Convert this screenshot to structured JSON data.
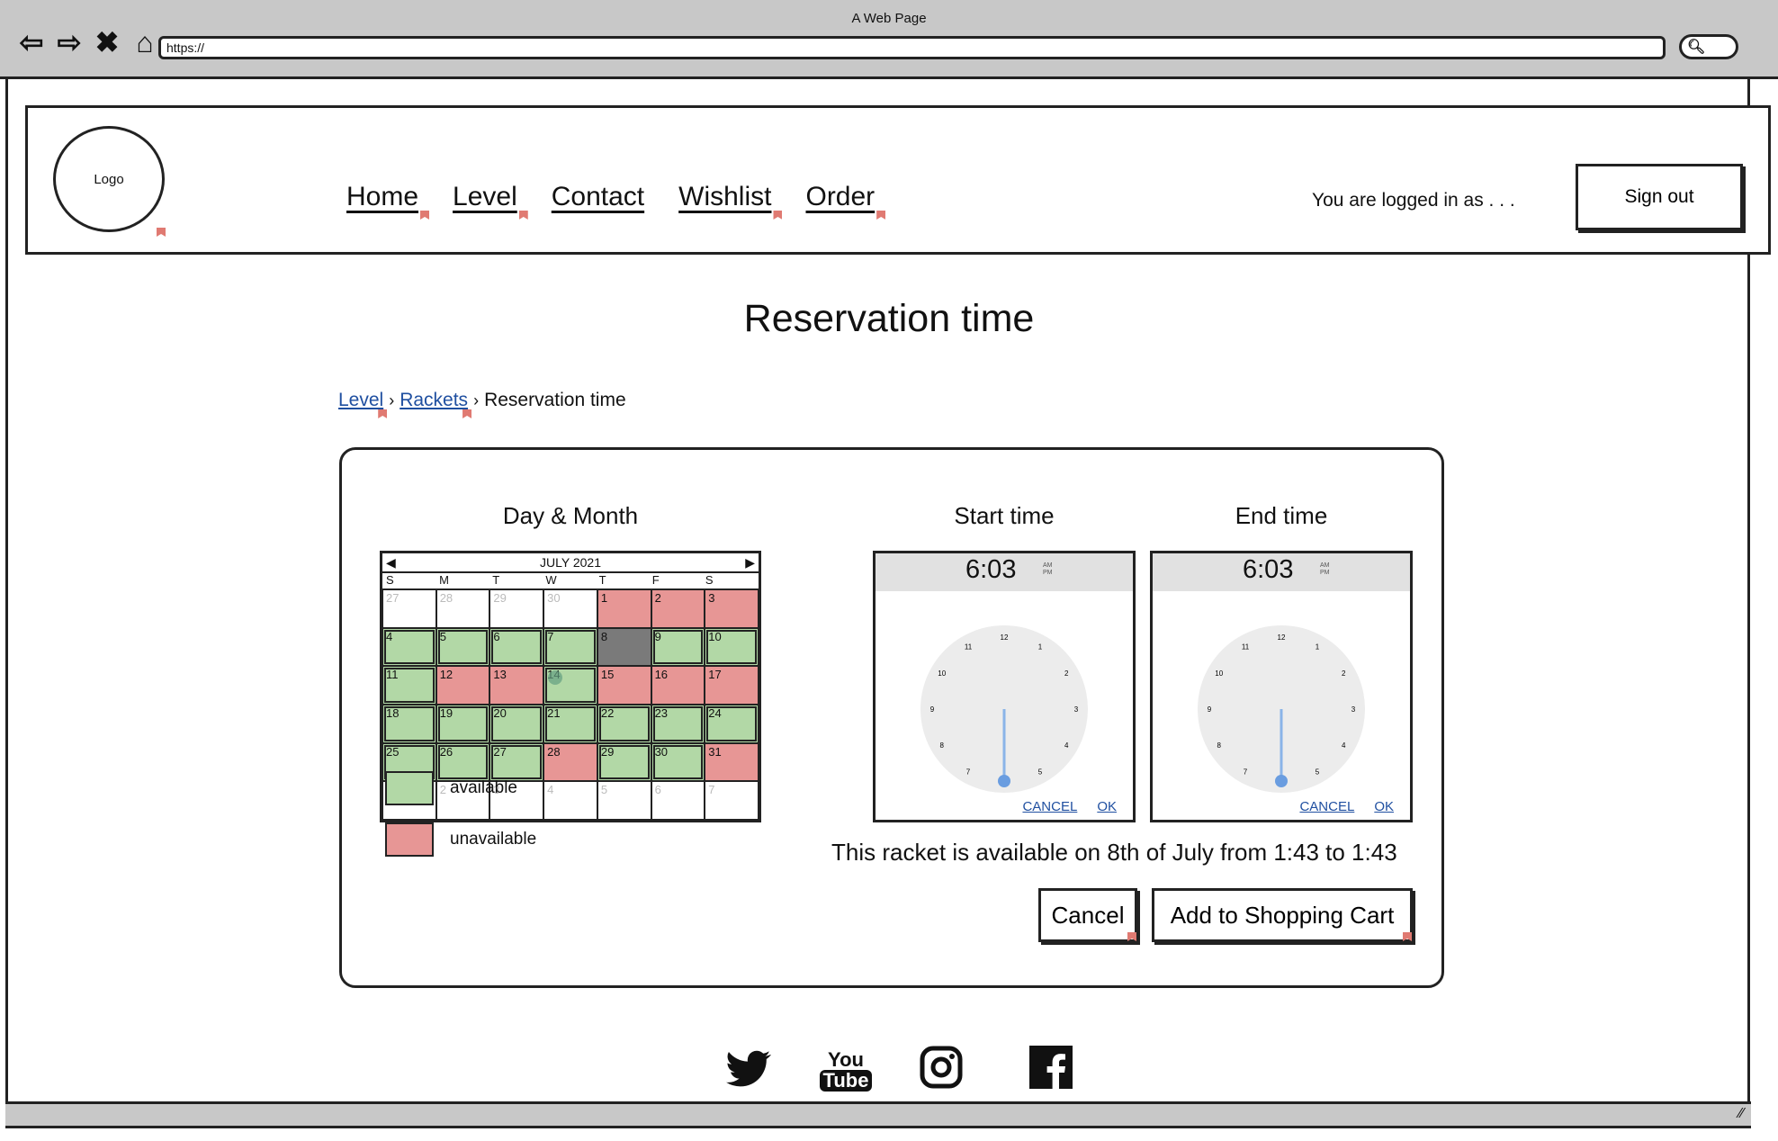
{
  "browser": {
    "title": "A Web Page",
    "url": "https://"
  },
  "header": {
    "logo_text": "Logo",
    "nav": [
      "Home",
      "Level",
      "Contact",
      "Wishlist",
      "Order"
    ],
    "logged_in_text": "You are logged in as . . .",
    "sign_out_label": "Sign out"
  },
  "page_title": "Reservation time",
  "breadcrumb": {
    "level": "Level",
    "rackets": "Rackets",
    "current": "Reservation time"
  },
  "calendar": {
    "heading": "Day & Month",
    "month_label": "JULY 2021",
    "weekdays": [
      "S",
      "M",
      "T",
      "W",
      "T",
      "F",
      "S"
    ],
    "days": [
      {
        "d": "27",
        "s": "other"
      },
      {
        "d": "28",
        "s": "other"
      },
      {
        "d": "29",
        "s": "other"
      },
      {
        "d": "30",
        "s": "other"
      },
      {
        "d": "1",
        "s": "unavail"
      },
      {
        "d": "2",
        "s": "unavail"
      },
      {
        "d": "3",
        "s": "unavail"
      },
      {
        "d": "4",
        "s": "avail"
      },
      {
        "d": "5",
        "s": "avail"
      },
      {
        "d": "6",
        "s": "avail"
      },
      {
        "d": "7",
        "s": "avail"
      },
      {
        "d": "8",
        "s": "selected"
      },
      {
        "d": "9",
        "s": "avail"
      },
      {
        "d": "10",
        "s": "avail"
      },
      {
        "d": "11",
        "s": "avail"
      },
      {
        "d": "12",
        "s": "unavail"
      },
      {
        "d": "13",
        "s": "unavail"
      },
      {
        "d": "14",
        "s": "avail today"
      },
      {
        "d": "15",
        "s": "unavail"
      },
      {
        "d": "16",
        "s": "unavail"
      },
      {
        "d": "17",
        "s": "unavail"
      },
      {
        "d": "18",
        "s": "avail"
      },
      {
        "d": "19",
        "s": "avail"
      },
      {
        "d": "20",
        "s": "avail"
      },
      {
        "d": "21",
        "s": "avail"
      },
      {
        "d": "22",
        "s": "avail"
      },
      {
        "d": "23",
        "s": "avail"
      },
      {
        "d": "24",
        "s": "avail"
      },
      {
        "d": "25",
        "s": "avail"
      },
      {
        "d": "26",
        "s": "avail"
      },
      {
        "d": "27",
        "s": "avail"
      },
      {
        "d": "28",
        "s": "unavail"
      },
      {
        "d": "29",
        "s": "avail"
      },
      {
        "d": "30",
        "s": "avail"
      },
      {
        "d": "31",
        "s": "unavail"
      },
      {
        "d": "1",
        "s": "other"
      },
      {
        "d": "2",
        "s": "other"
      },
      {
        "d": "3",
        "s": "other"
      },
      {
        "d": "4",
        "s": "other"
      },
      {
        "d": "5",
        "s": "other"
      },
      {
        "d": "6",
        "s": "other"
      },
      {
        "d": "7",
        "s": "other"
      }
    ]
  },
  "legend": {
    "available": "available",
    "unavailable": "unavailable",
    "available_color": "#b2d8a6",
    "unavailable_color": "#e79695"
  },
  "start_time": {
    "heading": "Start time",
    "time": "6:03",
    "am": "AM",
    "pm": "PM",
    "cancel": "CANCEL",
    "ok": "OK"
  },
  "end_time": {
    "heading": "End time",
    "time": "6:03",
    "am": "AM",
    "pm": "PM",
    "cancel": "CANCEL",
    "ok": "OK"
  },
  "clock_numbers": [
    "12",
    "1",
    "2",
    "3",
    "4",
    "5",
    "6",
    "7",
    "8",
    "9",
    "10",
    "11"
  ],
  "availability_text": "This racket is available on 8th of July from 1:43 to 1:43",
  "actions": {
    "cancel": "Cancel",
    "add_to_cart": "Add to Shopping Cart"
  },
  "social": [
    "twitter-icon",
    "youtube-icon",
    "instagram-icon",
    "facebook-icon"
  ]
}
